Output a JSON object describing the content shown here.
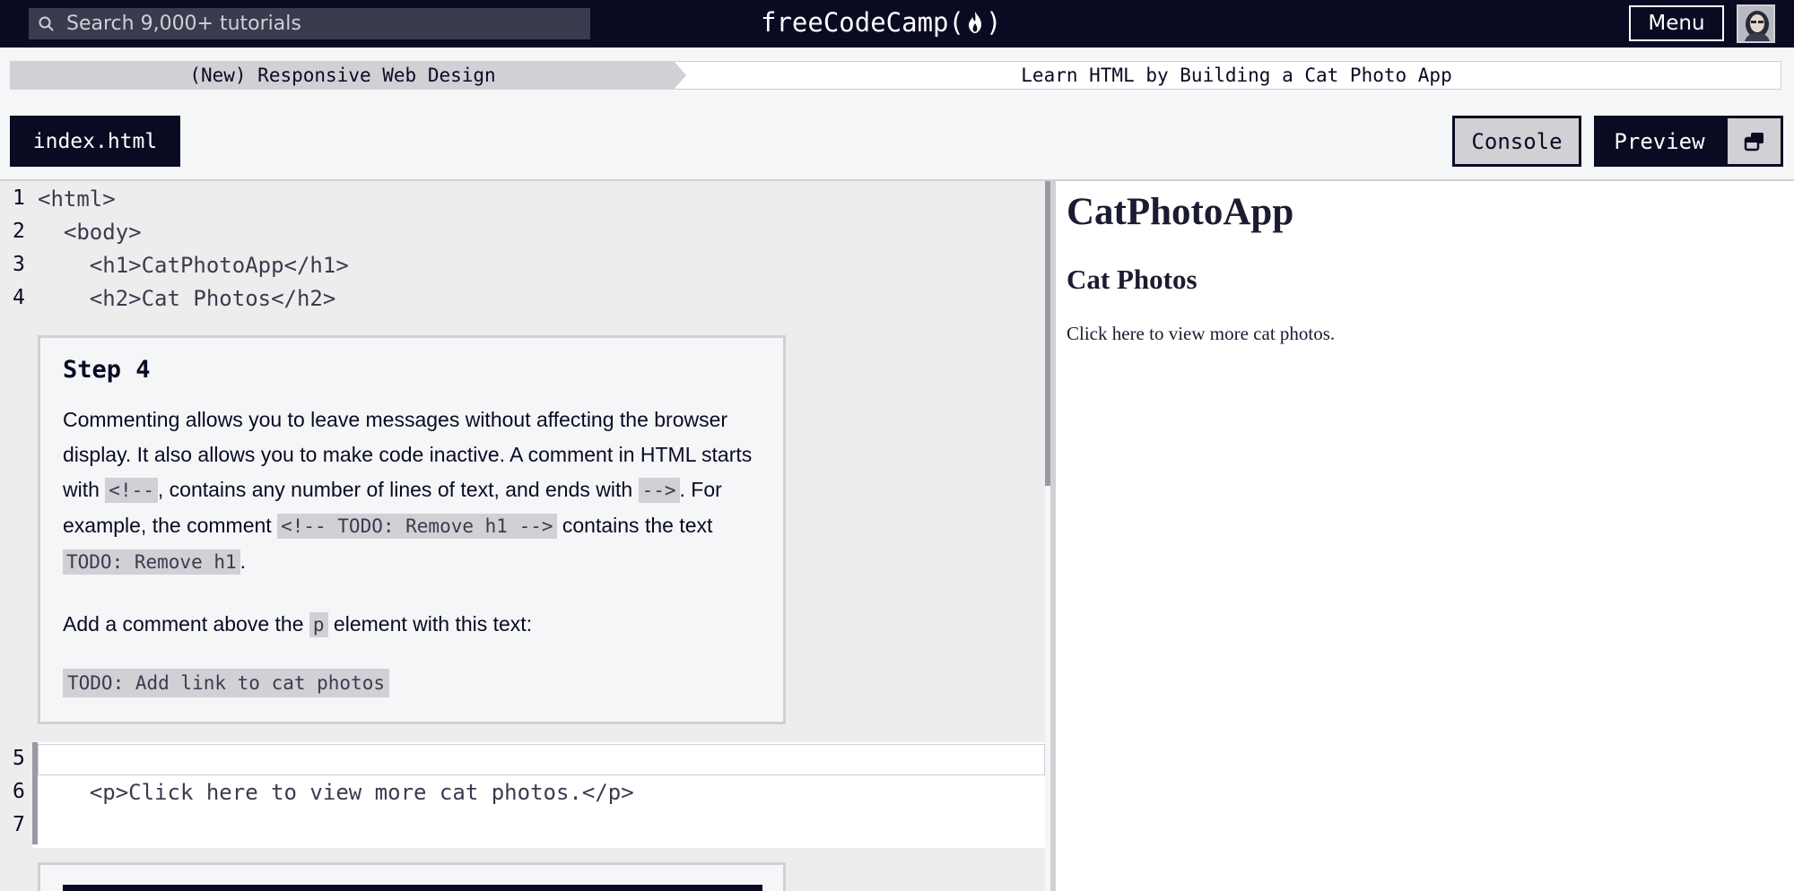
{
  "nav": {
    "search_placeholder": "Search 9,000+ tutorials",
    "logo_left": "freeCodeCamp(",
    "logo_right": ")",
    "menu_label": "Menu"
  },
  "breadcrumb": {
    "superblock": "(New) Responsive Web Design",
    "block": "Learn HTML by Building a Cat Photo App"
  },
  "toolbar": {
    "file_tab": "index.html",
    "console_label": "Console",
    "preview_label": "Preview"
  },
  "editor": {
    "lines": [
      {
        "num": "1",
        "text": "<html>"
      },
      {
        "num": "2",
        "text": "  <body>"
      },
      {
        "num": "3",
        "text": "    <h1>CatPhotoApp</h1>"
      },
      {
        "num": "4",
        "text": "    <h2>Cat Photos</h2>"
      },
      {
        "num": "5",
        "text": ""
      },
      {
        "num": "6",
        "text": "    <p>Click here to view more cat photos.</p>"
      },
      {
        "num": "7",
        "text": ""
      }
    ]
  },
  "step": {
    "title": "Step 4",
    "p1_a": "Commenting allows you to leave messages without affecting the browser display. It also allows you to make code inactive. A comment in HTML starts with ",
    "p1_code1": "<!--",
    "p1_b": ", contains any number of lines of text, and ends with ",
    "p1_code2": "-->",
    "p1_c": ". For example, the comment ",
    "p1_code3": "<!-- TODO: Remove h1 -->",
    "p1_d": " contains the text ",
    "p1_code4": "TODO: Remove h1",
    "p1_e": ".",
    "p2_a": "Add a comment above the ",
    "p2_code": "p",
    "p2_b": " element with this text:",
    "code_block": "TODO: Add link to cat photos"
  },
  "preview": {
    "h1": "CatPhotoApp",
    "h2": "Cat Photos",
    "p": "Click here to view more cat photos."
  },
  "colors": {
    "nav_bg": "#0a0a23",
    "crumb_bg": "#d0d0d5",
    "panel_border": "#d0d0d5"
  },
  "icons": [
    "search-icon",
    "flame-icon",
    "popout-icon",
    "avatar"
  ]
}
